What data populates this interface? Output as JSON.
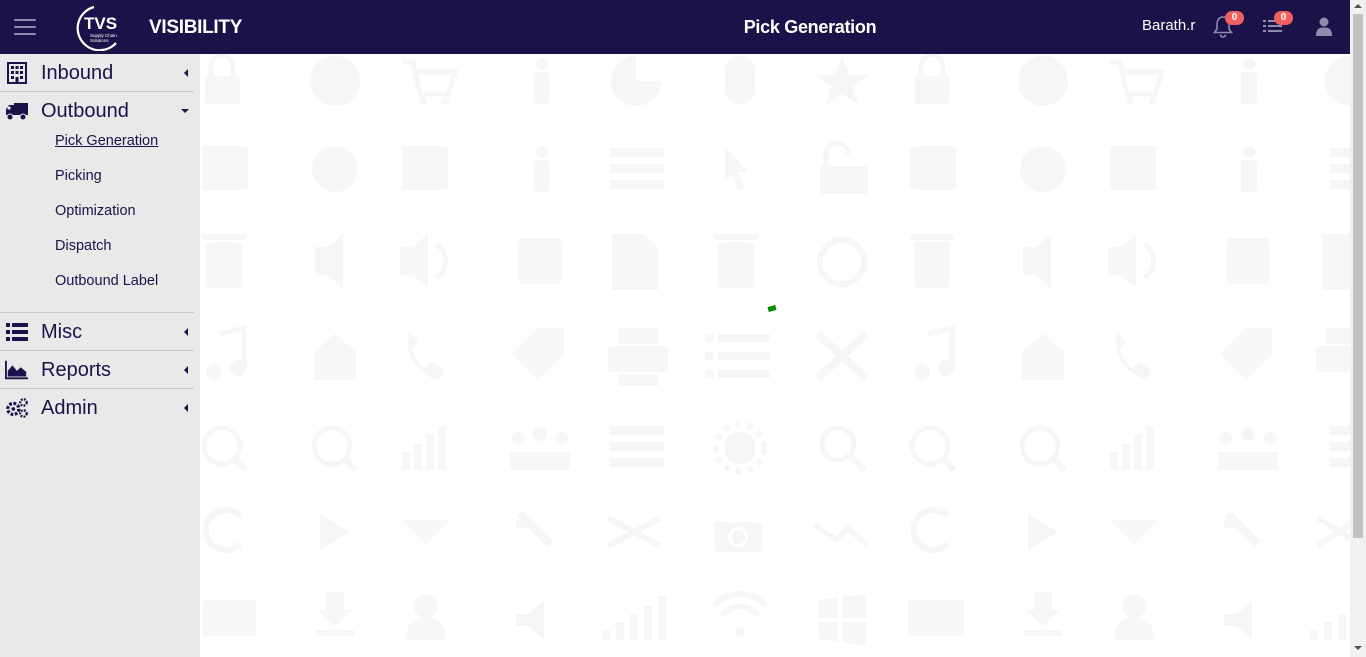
{
  "header": {
    "brand": "VISIBILITY",
    "page_title": "Pick Generation",
    "username": "Barath.r",
    "logo_text": "TVS",
    "logo_subtext": "Supply Chain Solutions",
    "notifications_count": "0",
    "tasks_count": "0",
    "icons": [
      "hamburger-icon",
      "bell-icon",
      "tasks-list-icon",
      "user-icon"
    ]
  },
  "sidebar": {
    "inbound": "Inbound",
    "outbound": "Outbound",
    "outbound_items": {
      "pick_generation": "Pick Generation",
      "picking": "Picking",
      "optimization": "Optimization",
      "dispatch": "Dispatch",
      "outbound_label": "Outbound Label"
    },
    "misc": "Misc",
    "reports": "Reports",
    "admin": "Admin"
  },
  "colors": {
    "header_bg": "#1b1249",
    "sidebar_bg": "#e9e9e9",
    "badge": "#f0605e",
    "loader": "#0a8a0a"
  }
}
